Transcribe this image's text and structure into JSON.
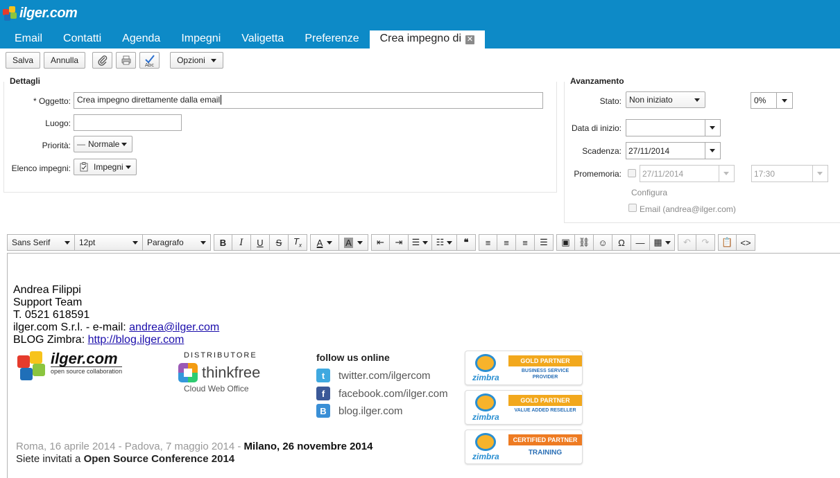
{
  "app": {
    "logo_text": "ilger.com",
    "tabs": [
      {
        "label": "Email"
      },
      {
        "label": "Contatti"
      },
      {
        "label": "Agenda"
      },
      {
        "label": "Impegni"
      },
      {
        "label": "Valigetta"
      },
      {
        "label": "Preferenze"
      },
      {
        "label": "Crea impegno di",
        "active": true
      }
    ]
  },
  "toolbar": {
    "save": "Salva",
    "cancel": "Annulla",
    "attach_icon": "paperclip-icon",
    "print_icon": "printer-icon",
    "spellcheck_icon": "spellcheck-icon",
    "options": "Opzioni"
  },
  "details": {
    "title": "Dettagli",
    "subject_label": "* Oggetto:",
    "subject_value": "Crea impegno direttamente dalla email",
    "location_label": "Luogo:",
    "location_value": "",
    "priority_label": "Priorità:",
    "priority_value": "Normale",
    "list_label": "Elenco impegni:",
    "list_value": "Impegni"
  },
  "progress": {
    "title": "Avanzamento",
    "status_label": "Stato:",
    "status_value": "Non iniziato",
    "percent_value": "0%",
    "start_label": "Data di inizio:",
    "start_value": "",
    "due_label": "Scadenza:",
    "due_value": "27/11/2014",
    "reminder_label": "Promemoria:",
    "reminder_date": "27/11/2014",
    "reminder_time": "17:30",
    "configure": "Configura",
    "email_reminder": "Email (andrea@ilger.com)"
  },
  "editor_toolbar": {
    "font_family": "Sans Serif",
    "font_size": "12pt",
    "block_format": "Paragrafo"
  },
  "signature": {
    "name": "Andrea Filippi",
    "team": "Support Team",
    "phone": "T. 0521 618591",
    "company_prefix": "ilger.com S.r.l. - e-mail: ",
    "email": "andrea@ilger.com",
    "blog_prefix": "BLOG Zimbra: ",
    "blog_url": "http://blog.ilger.com",
    "logo_name": "ilger.com",
    "logo_tagline": "open source collaboration",
    "distributor_label": "DISTRIBUTORE",
    "distributor_name": "thinkfree",
    "distributor_tagline": "Cloud Web Office",
    "follow_title": "follow us online",
    "social": [
      {
        "icon": "twitter-icon",
        "text": "twitter.com/ilgercom",
        "color": "#3fa9e0"
      },
      {
        "icon": "facebook-icon",
        "text": "facebook.com/ilger.com",
        "color": "#3b5998"
      },
      {
        "icon": "blogger-icon",
        "text": "blog.ilger.com",
        "color": "#3a8fd6"
      }
    ],
    "badges": [
      {
        "title": "GOLD PARTNER",
        "sub": "BUSINESS SERVICE PROVIDER",
        "color": "#f2a81d"
      },
      {
        "title": "GOLD PARTNER",
        "sub": "VALUE ADDED RESELLER",
        "color": "#f2a81d"
      },
      {
        "title": "CERTIFIED PARTNER",
        "sub": "TRAINING",
        "color": "#ee7b22"
      }
    ],
    "badge_brand": "zimbra",
    "conference_dates": "Roma, 16 aprile 2014 - Padova, 7 maggio 2014 - ",
    "conference_highlight": "Milano, 26 novembre 2014",
    "invite_prefix": "Siete invitati a ",
    "invite_event": "Open Source Conference 2014"
  },
  "colors": {
    "header_bg": "#0d8ac7",
    "link": "#1a0dab"
  }
}
